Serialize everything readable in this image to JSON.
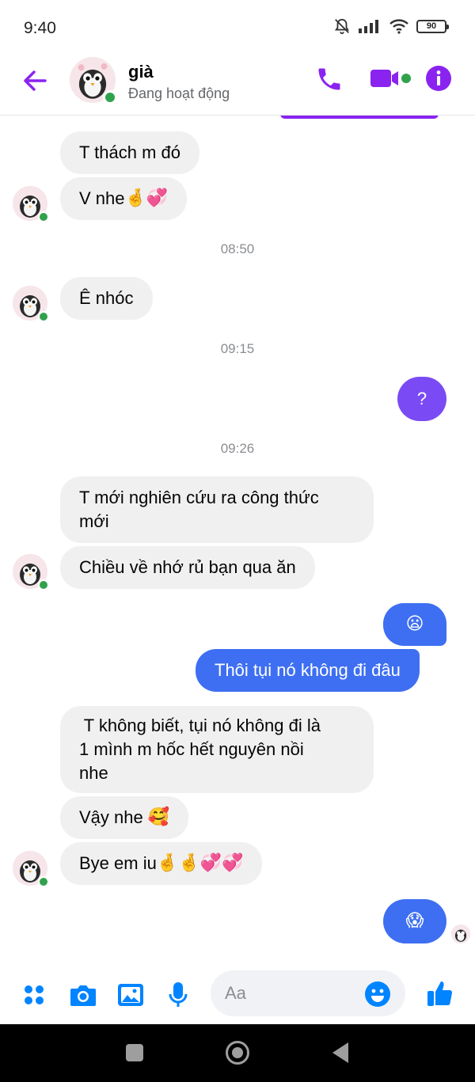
{
  "status_bar": {
    "time": "9:40",
    "battery": "90"
  },
  "header": {
    "contact_name": "già",
    "contact_status": "Đang hoạt động"
  },
  "messages": {
    "m1": "T thách m đó",
    "m2_text": "V nhe",
    "m2_emoji": "🤞💞",
    "ts1": "08:50",
    "m3": "Ê nhóc",
    "ts2": "09:15",
    "m4": "?",
    "ts3": "09:26",
    "m5_line1": "T mới nghiên cứu ra công thức",
    "m5_line2": "mới",
    "m6": "Chiều về nhớ rủ bạn qua ăn",
    "m7_emoji": "😦",
    "m8": "Thôi tụi nó không đi đâu",
    "m9_line1": " T không biết, tụi nó không đi là",
    "m9_line2": "1 mình m hốc hết nguyên nồi",
    "m9_line3": "nhe",
    "m10_text": "Vậy nhe",
    "m10_emoji": "🥰",
    "m11_text": "Bye em iu",
    "m11_emoji": "🤞🤞💞💞",
    "m12_emoji": "😱"
  },
  "composer": {
    "placeholder": "Aa"
  },
  "colors": {
    "accent": "#8a23f0",
    "sent_bubble_purple": "#7a4bf4",
    "sent_bubble_blue": "#3e6ff2",
    "received_bubble": "#f0f0f0",
    "online": "#31a24c",
    "composer_icon": "#0084ff"
  },
  "icons": {
    "status": [
      "mute-bell-icon",
      "signal-icon",
      "wifi-icon",
      "battery-icon"
    ],
    "header": [
      "back-arrow-icon",
      "phone-icon",
      "video-camera-icon",
      "info-icon"
    ],
    "composer": [
      "menu-dots-icon",
      "camera-icon",
      "image-icon",
      "microphone-icon",
      "emoji-icon",
      "thumbs-up-icon"
    ]
  }
}
